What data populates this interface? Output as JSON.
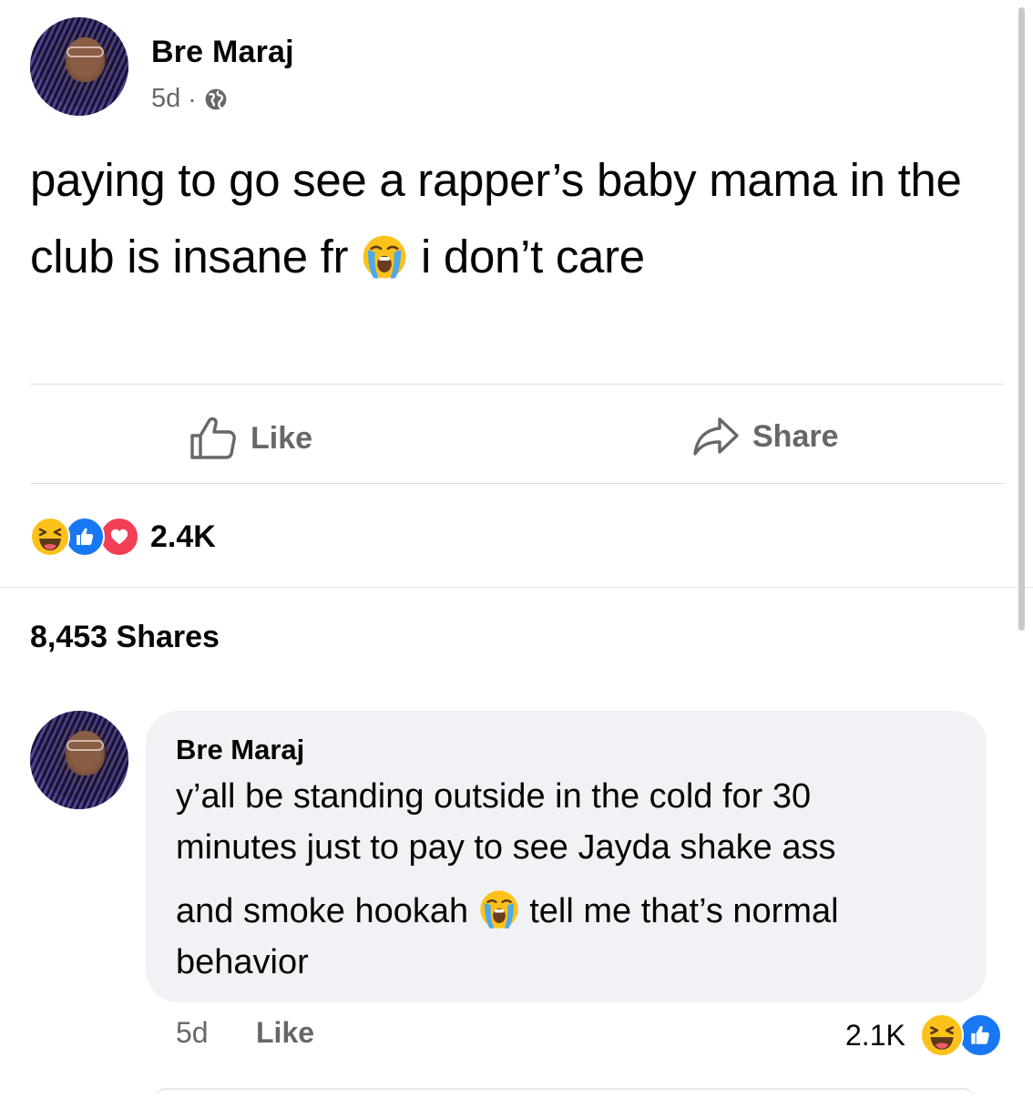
{
  "post": {
    "author": "Bre Maraj",
    "time": "5d",
    "separator": "·",
    "privacy_icon": "globe-icon",
    "text_before_emoji": "paying to go see a rapper’s baby mama in the club is insane fr",
    "emoji": "loudly-crying-face-icon",
    "text_after_emoji": "i don’t care"
  },
  "actions": {
    "like_label": "Like",
    "share_label": "Share"
  },
  "reactions": {
    "icons": [
      "laughing-face-icon",
      "like-thumb-icon",
      "love-heart-icon"
    ],
    "count": "2.4K"
  },
  "shares_label": "8,453 Shares",
  "comment": {
    "author": "Bre Maraj",
    "line1": "y’all be standing outside in the cold for 30",
    "line2": "minutes just to pay to see Jayda shake ass",
    "line3_before_emoji": "and smoke hookah",
    "emoji": "loudly-crying-face-icon",
    "line3_after_emoji": "tell me that’s normal",
    "line4": "behavior",
    "time": "5d",
    "like_label": "Like",
    "reaction_count": "2.1K",
    "reaction_icons": [
      "laughing-face-icon",
      "like-thumb-icon"
    ]
  },
  "colors": {
    "secondary_text": "#65676b",
    "like_blue": "#1877f2",
    "love_red": "#f33e58",
    "bubble_bg": "#f0f2f5"
  }
}
